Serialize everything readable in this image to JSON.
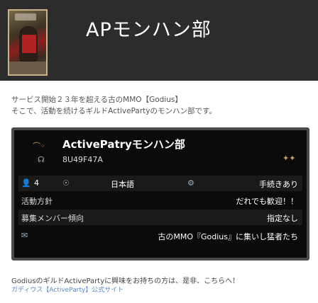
{
  "header": {
    "title": "APモンハン部"
  },
  "description": {
    "line1": "サービス開始２３年を超える古のMMO【Godius】",
    "line2": "そこで、活動を続けるギルドActivePartyのモンハン部です。"
  },
  "card": {
    "guild_name": "ActivePatryモンハン部",
    "guild_id": "8U49F47A",
    "members_icon": "person-icon",
    "members_count": "4",
    "language": "日本語",
    "join_type": "手続きあり",
    "activity_label": "活動方針",
    "activity_value": "だれでも歓迎！！",
    "recruit_label": "募集メンバー傾向",
    "recruit_value": "指定なし",
    "message": "古のMMO『Godius』に集いし猛者たち"
  },
  "footer": {
    "text": "GodiusのギルドActivePartyに興味をお持ちの方は、是非、こちらへ！",
    "link": "ガディウス【ActiveParty】公式サイト"
  },
  "colors": {
    "header_bg": "#2c2c2c",
    "card_bg": "#0b0b0b",
    "link": "#5a8ac6"
  }
}
